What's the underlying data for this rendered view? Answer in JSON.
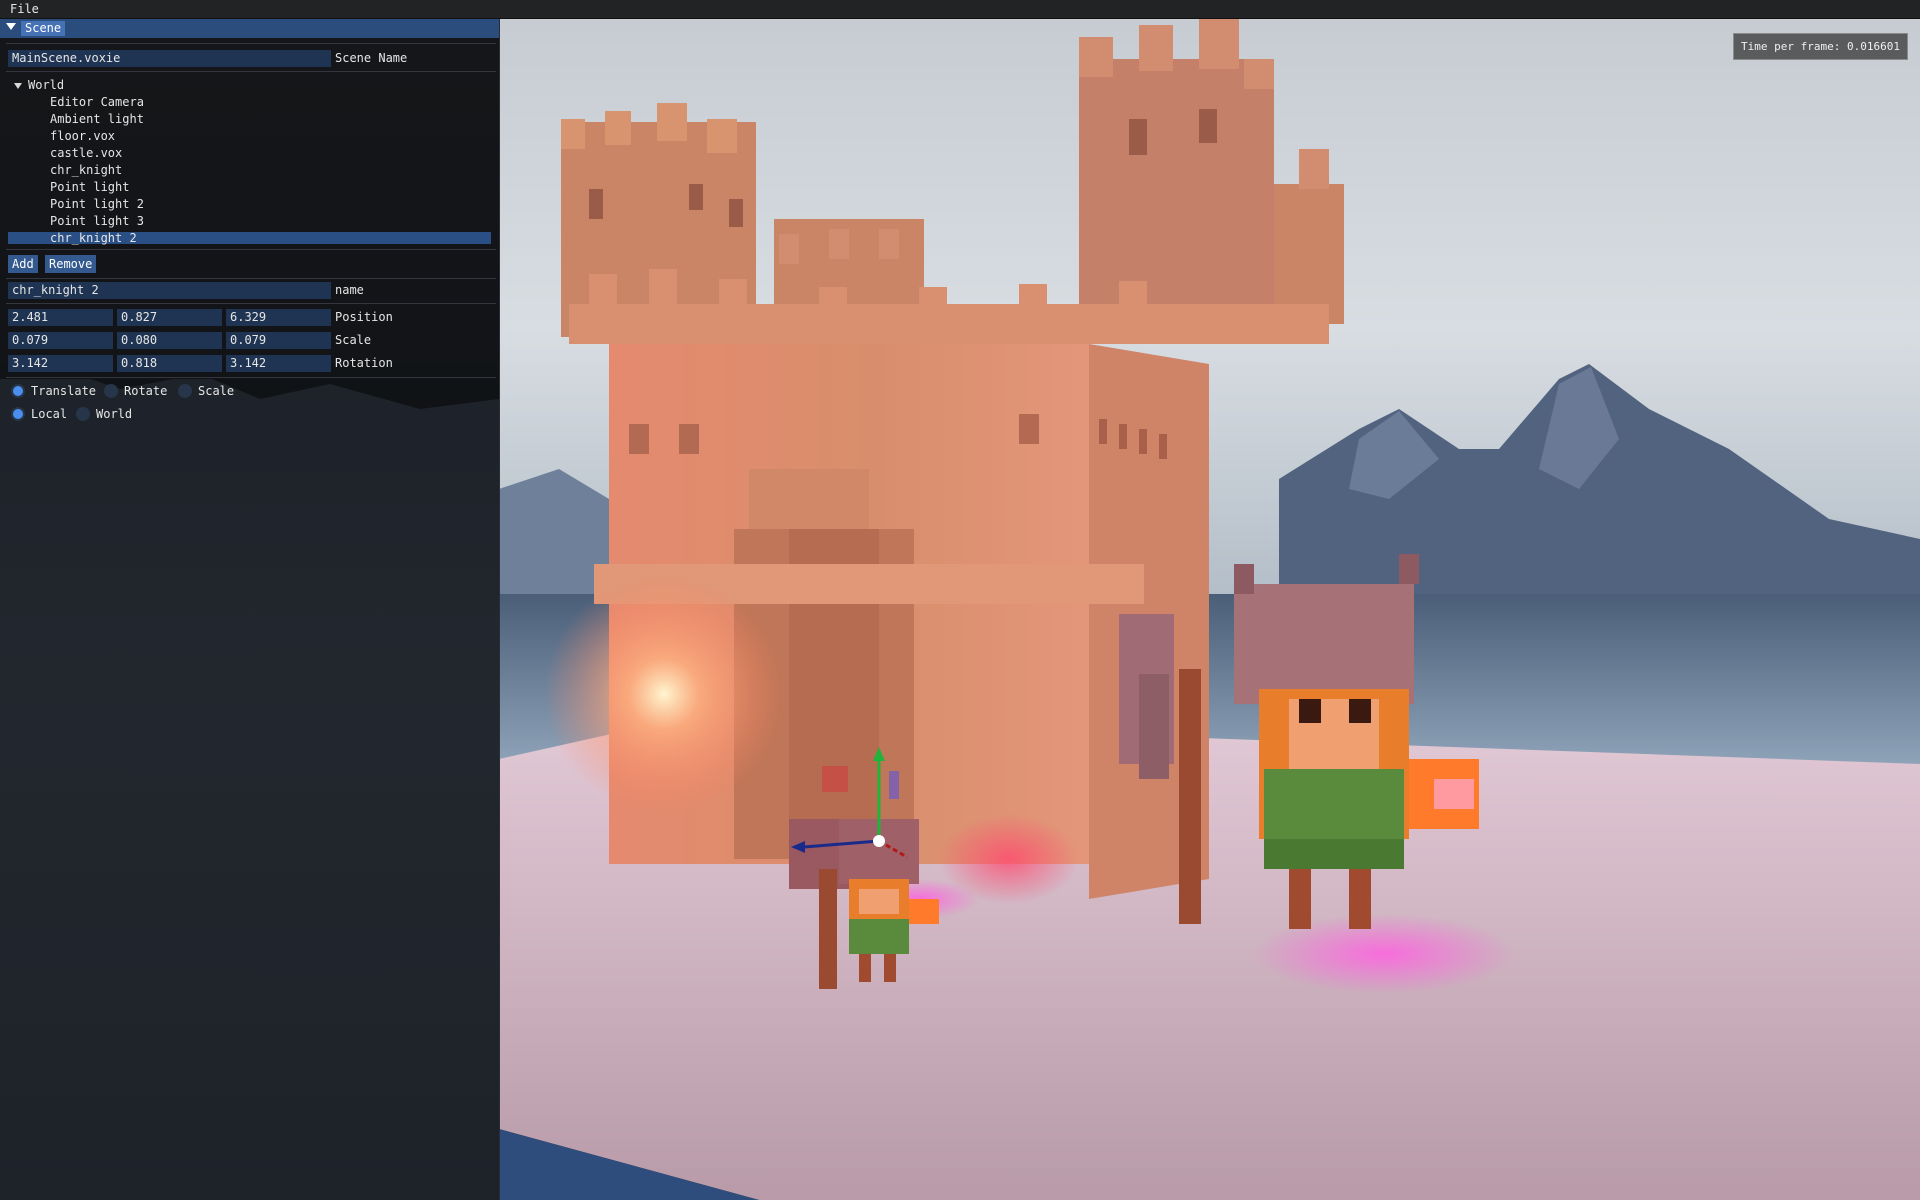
{
  "menu": {
    "file_label": "File"
  },
  "hud": {
    "frame_time": "Time per frame: 0.016601"
  },
  "panel": {
    "tab_label": "Scene",
    "scene_name_value": "MainScene.voxie",
    "scene_name_label": "Scene Name",
    "tree": {
      "root_label": "World",
      "items": [
        "Editor Camera",
        "Ambient light",
        "floor.vox",
        "castle.vox",
        "chr_knight",
        "Point light",
        "Point light 2",
        "Point light 3",
        "chr_knight 2"
      ],
      "selected_index": 8
    },
    "buttons": {
      "add": "Add",
      "remove": "Remove"
    },
    "name_value": "chr_knight 2",
    "name_label": "name",
    "transform": {
      "position": {
        "label": "Position",
        "values": [
          "2.481",
          "0.827",
          "6.329"
        ]
      },
      "scale": {
        "label": "Scale",
        "values": [
          "0.079",
          "0.080",
          "0.079"
        ]
      },
      "rotation": {
        "label": "Rotation",
        "values": [
          "3.142",
          "0.818",
          "3.142"
        ]
      }
    },
    "gizmo_mode": {
      "options": [
        "Translate",
        "Rotate",
        "Scale"
      ],
      "selected": "Translate"
    },
    "gizmo_space": {
      "options": [
        "Local",
        "World"
      ],
      "selected": "Local"
    }
  },
  "colors": {
    "accent": "#4572b5",
    "field_bg": "#1f3452",
    "selected_row": "#2a4f85",
    "castle": "#d98a68",
    "ground": "#dcbccc"
  }
}
